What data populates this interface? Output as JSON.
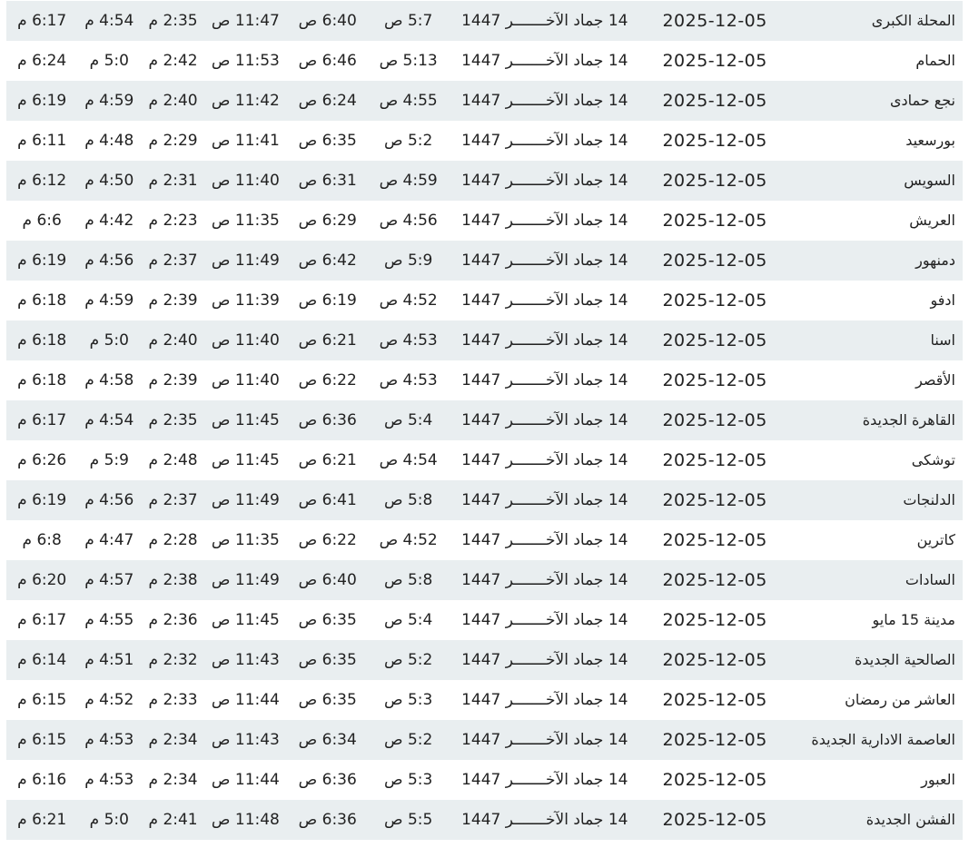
{
  "rows": [
    {
      "city": "المحلة الكبرى",
      "greg": "2025-12-05",
      "hijri": "14 جماد الآخـــــــر 1447",
      "fajr": "5:7 ص",
      "sunrise": "6:40 ص",
      "dhuhr": "11:47 ص",
      "asr": "2:35 م",
      "maghrib": "4:54 م",
      "isha": "6:17 م"
    },
    {
      "city": "الحمام",
      "greg": "2025-12-05",
      "hijri": "14 جماد الآخـــــــر 1447",
      "fajr": "5:13 ص",
      "sunrise": "6:46 ص",
      "dhuhr": "11:53 ص",
      "asr": "2:42 م",
      "maghrib": "5:0 م",
      "isha": "6:24 م"
    },
    {
      "city": "نجع حمادى",
      "greg": "2025-12-05",
      "hijri": "14 جماد الآخـــــــر 1447",
      "fajr": "4:55 ص",
      "sunrise": "6:24 ص",
      "dhuhr": "11:42 ص",
      "asr": "2:40 م",
      "maghrib": "4:59 م",
      "isha": "6:19 م"
    },
    {
      "city": "بورسعيد",
      "greg": "2025-12-05",
      "hijri": "14 جماد الآخـــــــر 1447",
      "fajr": "5:2 ص",
      "sunrise": "6:35 ص",
      "dhuhr": "11:41 ص",
      "asr": "2:29 م",
      "maghrib": "4:48 م",
      "isha": "6:11 م"
    },
    {
      "city": "السويس",
      "greg": "2025-12-05",
      "hijri": "14 جماد الآخـــــــر 1447",
      "fajr": "4:59 ص",
      "sunrise": "6:31 ص",
      "dhuhr": "11:40 ص",
      "asr": "2:31 م",
      "maghrib": "4:50 م",
      "isha": "6:12 م"
    },
    {
      "city": "العريش",
      "greg": "2025-12-05",
      "hijri": "14 جماد الآخـــــــر 1447",
      "fajr": "4:56 ص",
      "sunrise": "6:29 ص",
      "dhuhr": "11:35 ص",
      "asr": "2:23 م",
      "maghrib": "4:42 م",
      "isha": "6:6 م"
    },
    {
      "city": "دمنهور",
      "greg": "2025-12-05",
      "hijri": "14 جماد الآخـــــــر 1447",
      "fajr": "5:9 ص",
      "sunrise": "6:42 ص",
      "dhuhr": "11:49 ص",
      "asr": "2:37 م",
      "maghrib": "4:56 م",
      "isha": "6:19 م"
    },
    {
      "city": "ادفو",
      "greg": "2025-12-05",
      "hijri": "14 جماد الآخـــــــر 1447",
      "fajr": "4:52 ص",
      "sunrise": "6:19 ص",
      "dhuhr": "11:39 ص",
      "asr": "2:39 م",
      "maghrib": "4:59 م",
      "isha": "6:18 م"
    },
    {
      "city": "اسنا",
      "greg": "2025-12-05",
      "hijri": "14 جماد الآخـــــــر 1447",
      "fajr": "4:53 ص",
      "sunrise": "6:21 ص",
      "dhuhr": "11:40 ص",
      "asr": "2:40 م",
      "maghrib": "5:0 م",
      "isha": "6:18 م"
    },
    {
      "city": "الأقصر",
      "greg": "2025-12-05",
      "hijri": "14 جماد الآخـــــــر 1447",
      "fajr": "4:53 ص",
      "sunrise": "6:22 ص",
      "dhuhr": "11:40 ص",
      "asr": "2:39 م",
      "maghrib": "4:58 م",
      "isha": "6:18 م"
    },
    {
      "city": "القاهرة الجديدة",
      "greg": "2025-12-05",
      "hijri": "14 جماد الآخـــــــر 1447",
      "fajr": "5:4 ص",
      "sunrise": "6:36 ص",
      "dhuhr": "11:45 ص",
      "asr": "2:35 م",
      "maghrib": "4:54 م",
      "isha": "6:17 م"
    },
    {
      "city": "توشكى",
      "greg": "2025-12-05",
      "hijri": "14 جماد الآخـــــــر 1447",
      "fajr": "4:54 ص",
      "sunrise": "6:21 ص",
      "dhuhr": "11:45 ص",
      "asr": "2:48 م",
      "maghrib": "5:9 م",
      "isha": "6:26 م"
    },
    {
      "city": "الدلنجات",
      "greg": "2025-12-05",
      "hijri": "14 جماد الآخـــــــر 1447",
      "fajr": "5:8 ص",
      "sunrise": "6:41 ص",
      "dhuhr": "11:49 ص",
      "asr": "2:37 م",
      "maghrib": "4:56 م",
      "isha": "6:19 م"
    },
    {
      "city": "كاترين",
      "greg": "2025-12-05",
      "hijri": "14 جماد الآخـــــــر 1447",
      "fajr": "4:52 ص",
      "sunrise": "6:22 ص",
      "dhuhr": "11:35 ص",
      "asr": "2:28 م",
      "maghrib": "4:47 م",
      "isha": "6:8 م"
    },
    {
      "city": "السادات",
      "greg": "2025-12-05",
      "hijri": "14 جماد الآخـــــــر 1447",
      "fajr": "5:8 ص",
      "sunrise": "6:40 ص",
      "dhuhr": "11:49 ص",
      "asr": "2:38 م",
      "maghrib": "4:57 م",
      "isha": "6:20 م"
    },
    {
      "city": "مدينة 15 مايو",
      "greg": "2025-12-05",
      "hijri": "14 جماد الآخـــــــر 1447",
      "fajr": "5:4 ص",
      "sunrise": "6:35 ص",
      "dhuhr": "11:45 ص",
      "asr": "2:36 م",
      "maghrib": "4:55 م",
      "isha": "6:17 م"
    },
    {
      "city": "الصالحية الجديدة",
      "greg": "2025-12-05",
      "hijri": "14 جماد الآخـــــــر 1447",
      "fajr": "5:2 ص",
      "sunrise": "6:35 ص",
      "dhuhr": "11:43 ص",
      "asr": "2:32 م",
      "maghrib": "4:51 م",
      "isha": "6:14 م"
    },
    {
      "city": "العاشر من رمضان",
      "greg": "2025-12-05",
      "hijri": "14 جماد الآخـــــــر 1447",
      "fajr": "5:3 ص",
      "sunrise": "6:35 ص",
      "dhuhr": "11:44 ص",
      "asr": "2:33 م",
      "maghrib": "4:52 م",
      "isha": "6:15 م"
    },
    {
      "city": "العاصمة الادارية الجديدة",
      "greg": "2025-12-05",
      "hijri": "14 جماد الآخـــــــر 1447",
      "fajr": "5:2 ص",
      "sunrise": "6:34 ص",
      "dhuhr": "11:43 ص",
      "asr": "2:34 م",
      "maghrib": "4:53 م",
      "isha": "6:15 م"
    },
    {
      "city": "العبور",
      "greg": "2025-12-05",
      "hijri": "14 جماد الآخـــــــر 1447",
      "fajr": "5:3 ص",
      "sunrise": "6:36 ص",
      "dhuhr": "11:44 ص",
      "asr": "2:34 م",
      "maghrib": "4:53 م",
      "isha": "6:16 م"
    },
    {
      "city": "الفشن الجديدة",
      "greg": "2025-12-05",
      "hijri": "14 جماد الآخـــــــر 1447",
      "fajr": "5:5 ص",
      "sunrise": "6:36 ص",
      "dhuhr": "11:48 ص",
      "asr": "2:41 م",
      "maghrib": "5:0 م",
      "isha": "6:21 م"
    }
  ]
}
